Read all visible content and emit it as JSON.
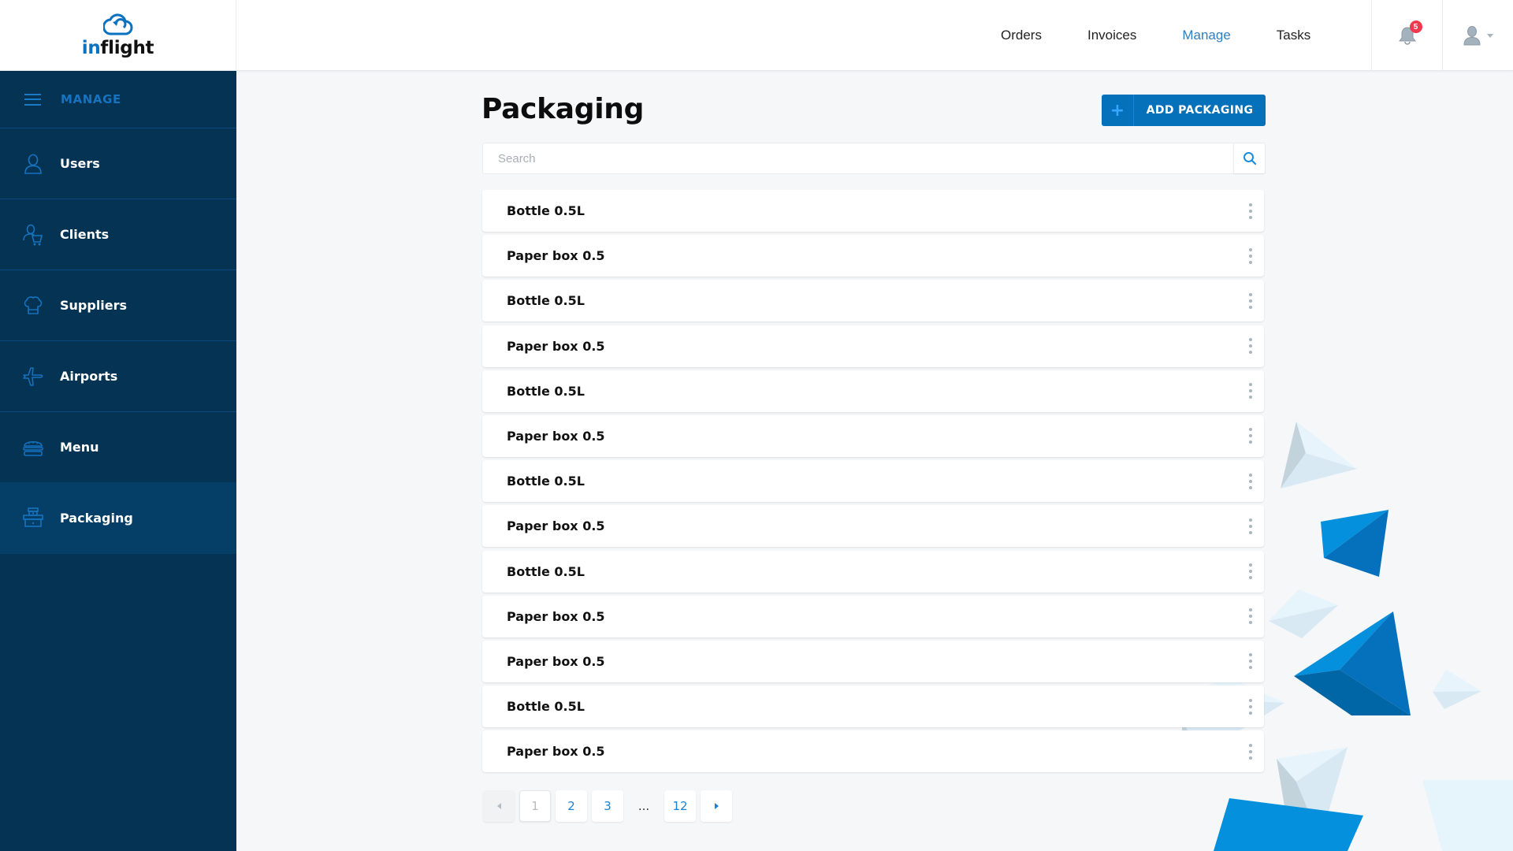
{
  "brand": {
    "logo_prefix": "in",
    "logo_suffix": "flight"
  },
  "topnav": {
    "items": [
      {
        "label": "Orders",
        "active": false
      },
      {
        "label": "Invoices",
        "active": false
      },
      {
        "label": "Manage",
        "active": true
      },
      {
        "label": "Tasks",
        "active": false
      }
    ],
    "notifications": {
      "icon": "bell-icon",
      "count": "5"
    },
    "user": {
      "icon": "user-avatar-icon",
      "menu_icon": "caret-down-icon"
    }
  },
  "sidebar": {
    "section_label": "MANAGE",
    "items": [
      {
        "label": "Users",
        "icon": "user-icon",
        "active": false
      },
      {
        "label": "Clients",
        "icon": "client-cart-icon",
        "active": false
      },
      {
        "label": "Suppliers",
        "icon": "chef-hat-icon",
        "active": false
      },
      {
        "label": "Airports",
        "icon": "airplane-icon",
        "active": false
      },
      {
        "label": "Menu",
        "icon": "burger-icon",
        "active": false
      },
      {
        "label": "Packaging",
        "icon": "packaging-box-icon",
        "active": true
      }
    ]
  },
  "main": {
    "title": "Packaging",
    "add_button": {
      "icon": "+",
      "label": "ADD PACKAGING"
    },
    "search": {
      "placeholder": "Search",
      "value": ""
    },
    "items": [
      "Bottle 0.5L",
      "Paper box 0.5",
      "Bottle 0.5L",
      "Paper box 0.5",
      "Bottle 0.5L",
      "Paper box 0.5",
      "Bottle 0.5L",
      "Paper box 0.5",
      "Bottle 0.5L",
      "Paper box 0.5",
      "Paper box 0.5",
      "Bottle 0.5L",
      "Paper box 0.5"
    ],
    "pagination": {
      "current": "1",
      "pages": [
        "1",
        "2",
        "3"
      ],
      "ellipsis": "...",
      "last": "12"
    }
  },
  "colors": {
    "accent": "#0571bb",
    "sidebar_bg": "#053353",
    "sidebar_active": "#053e66",
    "badge": "#f0384f",
    "nav_active": "#2d7fc1"
  }
}
